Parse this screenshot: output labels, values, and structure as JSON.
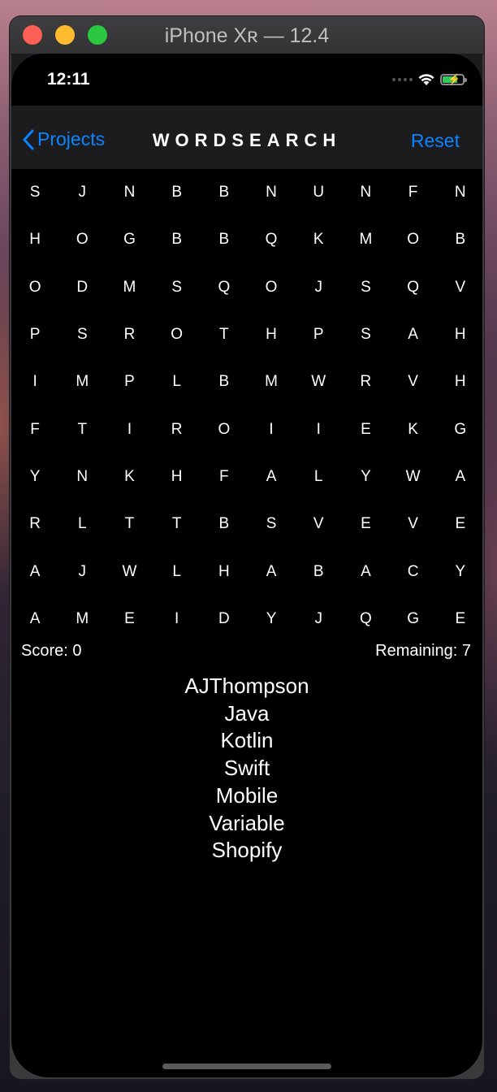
{
  "window": {
    "title": "iPhone Xʀ — 12.4"
  },
  "status_bar": {
    "time": "12:11"
  },
  "navbar": {
    "back_label": "Projects",
    "title": "WORDSEARCH",
    "reset_label": "Reset"
  },
  "grid": {
    "rows": [
      [
        "S",
        "J",
        "N",
        "B",
        "B",
        "N",
        "U",
        "N",
        "F",
        "N"
      ],
      [
        "H",
        "O",
        "G",
        "B",
        "B",
        "Q",
        "K",
        "M",
        "O",
        "B"
      ],
      [
        "O",
        "D",
        "M",
        "S",
        "Q",
        "O",
        "J",
        "S",
        "Q",
        "V"
      ],
      [
        "P",
        "S",
        "R",
        "O",
        "T",
        "H",
        "P",
        "S",
        "A",
        "H"
      ],
      [
        "I",
        "M",
        "P",
        "L",
        "B",
        "M",
        "W",
        "R",
        "V",
        "H"
      ],
      [
        "F",
        "T",
        "I",
        "R",
        "O",
        "I",
        "I",
        "E",
        "K",
        "G"
      ],
      [
        "Y",
        "N",
        "K",
        "H",
        "F",
        "A",
        "L",
        "Y",
        "W",
        "A"
      ],
      [
        "R",
        "L",
        "T",
        "T",
        "B",
        "S",
        "V",
        "E",
        "V",
        "E"
      ],
      [
        "A",
        "J",
        "W",
        "L",
        "H",
        "A",
        "B",
        "A",
        "C",
        "Y"
      ],
      [
        "A",
        "M",
        "E",
        "I",
        "D",
        "Y",
        "J",
        "Q",
        "G",
        "E"
      ]
    ]
  },
  "score": {
    "label": "Score: 0",
    "remaining": "Remaining: 7"
  },
  "words": [
    "AJThompson",
    "Java",
    "Kotlin",
    "Swift",
    "Mobile",
    "Variable",
    "Shopify"
  ],
  "colors": {
    "accent": "#0a84ff",
    "background": "#000000",
    "navbar": "#1c1c1e",
    "battery": "#34c759"
  },
  "icons": [
    "chevron-left-icon",
    "wifi-icon",
    "battery-charging-icon",
    "cellular-signal-icon"
  ]
}
